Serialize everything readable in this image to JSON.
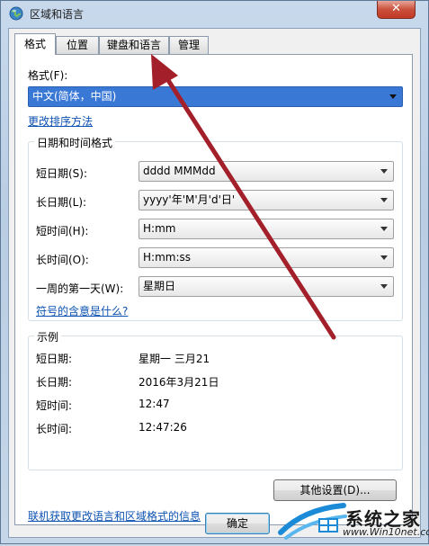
{
  "window": {
    "title": "区域和语言",
    "close_glyph": "✕"
  },
  "tabs": [
    {
      "label": "格式",
      "active": true
    },
    {
      "label": "位置",
      "active": false
    },
    {
      "label": "键盘和语言",
      "active": false
    },
    {
      "label": "管理",
      "active": false
    }
  ],
  "format": {
    "label": "格式(F):",
    "value": "中文(简体，中国)",
    "sort_link": "更改排序方法"
  },
  "datetime_group": {
    "title": "日期和时间格式",
    "rows": [
      {
        "label": "短日期(S):",
        "value": "dddd  MMMdd"
      },
      {
        "label": "长日期(L):",
        "value": "yyyy'年'M'月'd'日'"
      },
      {
        "label": "短时间(H):",
        "value": "H:mm"
      },
      {
        "label": "长时间(O):",
        "value": "H:mm:ss"
      },
      {
        "label": "一周的第一天(W):",
        "value": "星期日"
      }
    ],
    "symbols_link": "符号的含意是什么?"
  },
  "examples": {
    "title": "示例",
    "rows": [
      {
        "label": "短日期:",
        "value": "星期一  三月21"
      },
      {
        "label": "长日期:",
        "value": "2016年3月21日"
      },
      {
        "label": "短时间:",
        "value": "12:47"
      },
      {
        "label": "长时间:",
        "value": "12:47:26"
      }
    ]
  },
  "other_settings_button": "其他设置(D)...",
  "online_link": "联机获取更改语言和区域格式的信息",
  "ok_button": "确定",
  "watermark": {
    "text": "系统之家",
    "sub": "www.Win10net.com"
  },
  "colors": {
    "annotation_arrow": "#a3202a",
    "link": "#0b52b2",
    "selection": "#3a78d6"
  },
  "icons": {
    "app": "globe-icon",
    "close": "close-icon",
    "dropdown": "chevron-down-icon"
  }
}
